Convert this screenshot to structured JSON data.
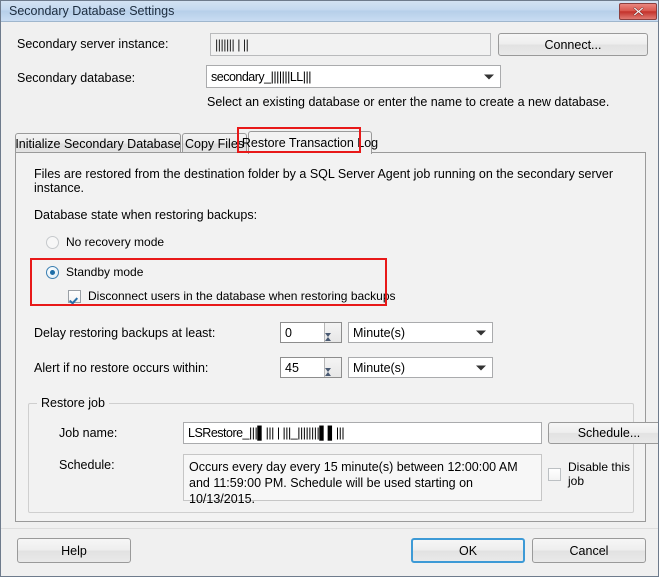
{
  "window": {
    "title": "Secondary Database Settings",
    "close_icon": "close-icon",
    "close_glyph": "✕"
  },
  "form": {
    "server_instance_label": "Secondary server instance:",
    "server_instance_value": "||||||| | ||",
    "connect_button": "Connect...",
    "database_label": "Secondary database:",
    "database_value": "secondary_|||||||LL|||",
    "database_hint": "Select an existing database or enter the name to create a new database."
  },
  "tabs": [
    {
      "label": "Initialize Secondary Database",
      "selected": false
    },
    {
      "label": "Copy Files",
      "selected": false
    },
    {
      "label": "Restore Transaction Log",
      "selected": true
    }
  ],
  "panel": {
    "description": "Files are restored from the destination folder by a SQL Server Agent job running on the secondary server instance.",
    "state_label": "Database state when restoring backups:",
    "no_recovery_label": "No recovery mode",
    "no_recovery_selected": false,
    "standby_label": "Standby mode",
    "standby_selected": true,
    "disconnect_label": "Disconnect users in the database when restoring backups",
    "disconnect_checked": true,
    "delay_label": "Delay restoring backups at least:",
    "delay_value": "0",
    "delay_unit": "Minute(s)",
    "alert_label": "Alert if no restore occurs within:",
    "alert_value": "45",
    "alert_unit": "Minute(s)"
  },
  "restore_job": {
    "group_title": "Restore job",
    "job_name_label": "Job name:",
    "job_name_value": "LSRestore_|||▌||| | |||_||||||||▌▌|||",
    "schedule_button": "Schedule...",
    "schedule_label": "Schedule:",
    "schedule_value": "Occurs every day every 15 minute(s) between 12:00:00 AM and 11:59:00 PM. Schedule will be used starting on 10/13/2015.",
    "disable_job_label": "Disable this job",
    "disable_job_checked": false
  },
  "footer": {
    "help_button": "Help",
    "ok_button": "OK",
    "cancel_button": "Cancel"
  },
  "colors": {
    "annotation": "#e81919",
    "focus": "#3d9ad6",
    "title_bar": "#c3d8ef"
  }
}
